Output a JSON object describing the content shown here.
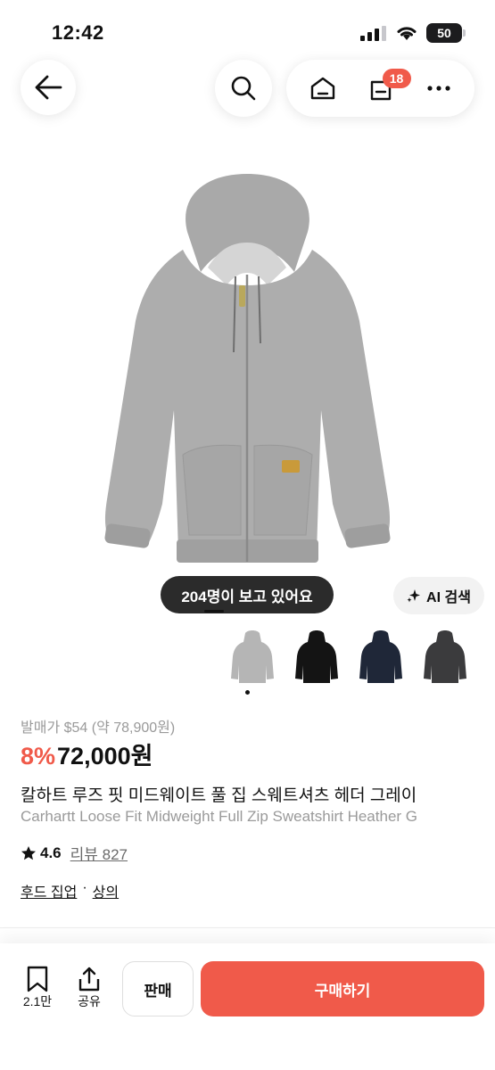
{
  "status_bar": {
    "time": "12:42",
    "battery": "50"
  },
  "nav": {
    "cart_badge": "18"
  },
  "product": {
    "viewers_text": "204명이 보고 있어요",
    "ai_search_label": "AI 검색",
    "colors": [
      "heather-gray",
      "black",
      "navy",
      "dark-gray"
    ],
    "color_hex": {
      "heather_gray": "#b5b5b5",
      "black": "#141414",
      "navy": "#1f2738",
      "dark_gray": "#3b3b3d"
    },
    "original_price": "발매가 $54 (약 78,900원)",
    "discount": "8%",
    "price": "72,000원",
    "title_ko": "칼하트 루즈 핏 미드웨이트 풀 집 스웨트셔츠 헤더 그레이",
    "title_en": "Carhartt Loose Fit Midweight Full Zip Sweatshirt Heather G",
    "rating": "4.6",
    "reviews": "리뷰 827",
    "category_1": "후드 집업",
    "category_sep": "·",
    "category_2": "상의"
  },
  "bottom": {
    "like_count": "2.1만",
    "share_label": "공유",
    "sell_label": "판매",
    "buy_label": "구매하기"
  },
  "colors": {
    "accent": "#f05a4a",
    "pill_dark": "#2b2b2b"
  }
}
